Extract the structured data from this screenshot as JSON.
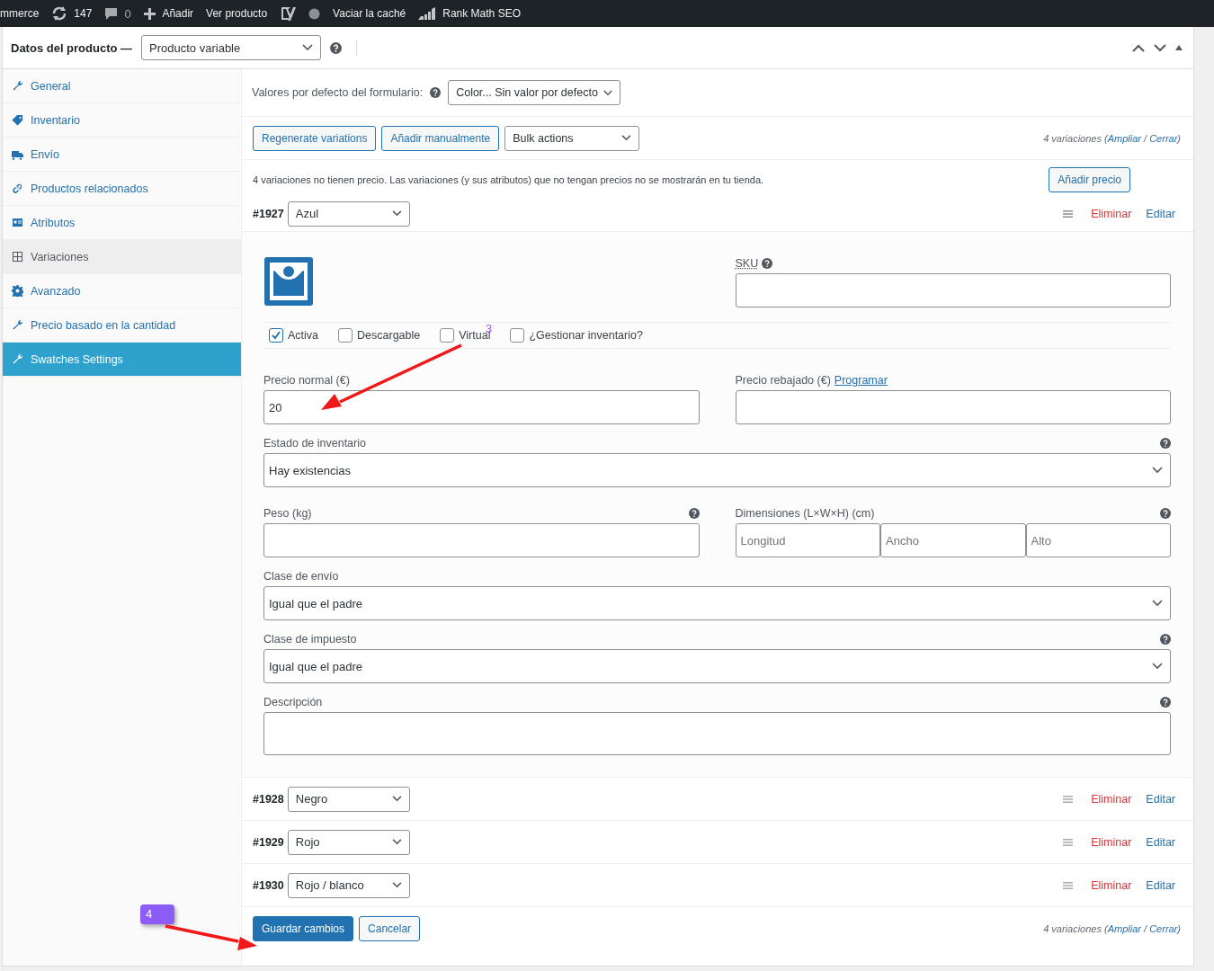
{
  "admin_bar": {
    "items": [
      {
        "kind": "text",
        "label": "mmerce"
      },
      {
        "kind": "updates",
        "label": "147"
      },
      {
        "kind": "comments",
        "label": "0"
      },
      {
        "kind": "add",
        "label": "Añadir"
      },
      {
        "kind": "text",
        "label": "Ver producto"
      },
      {
        "kind": "yoast"
      },
      {
        "kind": "status-dot"
      },
      {
        "kind": "text",
        "label": "Vaciar la caché"
      },
      {
        "kind": "rankmath",
        "label": "Rank Math SEO"
      }
    ]
  },
  "panel": {
    "title": "Datos del producto —",
    "product_type": "Producto variable"
  },
  "tabs": [
    {
      "label": "General",
      "selected": false,
      "highlighted": false
    },
    {
      "label": "Inventario",
      "selected": false,
      "highlighted": false
    },
    {
      "label": "Envío",
      "selected": false,
      "highlighted": false
    },
    {
      "label": "Productos relacionados",
      "selected": false,
      "highlighted": false
    },
    {
      "label": "Atributos",
      "selected": false,
      "highlighted": false
    },
    {
      "label": "Variaciones",
      "selected": true,
      "highlighted": false
    },
    {
      "label": "Avanzado",
      "selected": false,
      "highlighted": false
    },
    {
      "label": "Precio basado en la cantidad",
      "selected": false,
      "highlighted": false
    },
    {
      "label": "Swatches Settings",
      "selected": false,
      "highlighted": true
    }
  ],
  "defaults": {
    "label": "Valores por defecto del formulario:",
    "value": "Color... Sin valor por defecto"
  },
  "toolbar": {
    "buttons": [
      "Regenerate variations",
      "Añadir manualmente"
    ],
    "bulk": "Bulk actions",
    "summary": [
      {
        "kind": "text",
        "text": "4 variaciones ("
      },
      {
        "kind": "link",
        "text": "Ampliar"
      },
      {
        "kind": "text",
        "text": " / "
      },
      {
        "kind": "link",
        "text": "Cerrar"
      },
      {
        "kind": "text",
        "text": ")"
      }
    ]
  },
  "notice": {
    "text": "4 variaciones no tienen precio. Las variaciones (y sus atributos) que no tengan precios no se mostrarán en tu tienda.",
    "button": "Añadir precio"
  },
  "variations": [
    {
      "id": "#1927",
      "value": "Azul",
      "expanded": true,
      "remove": "Eliminar",
      "edit": "Editar"
    },
    {
      "id": "#1928",
      "value": "Negro",
      "expanded": false,
      "remove": "Eliminar",
      "edit": "Editar"
    },
    {
      "id": "#1929",
      "value": "Rojo",
      "expanded": false,
      "remove": "Eliminar",
      "edit": "Editar"
    },
    {
      "id": "#1930",
      "value": "Rojo / blanco",
      "expanded": false,
      "remove": "Eliminar",
      "edit": "Editar"
    }
  ],
  "variation_form": {
    "sku": "SKU",
    "checkboxes": [
      {
        "label": "Activa",
        "checked": true
      },
      {
        "label": "Descargable",
        "checked": false
      },
      {
        "label": "Virtual",
        "checked": false
      },
      {
        "label": "¿Gestionar inventario?",
        "checked": false
      }
    ],
    "regular_price": {
      "label": "Precio normal (€)",
      "value": "20"
    },
    "sale_price": {
      "label": "Precio rebajado (€)",
      "link": "Programar"
    },
    "stock": {
      "label": "Estado de inventario",
      "value": "Hay existencias"
    },
    "weight": {
      "label": "Peso (kg)"
    },
    "dimensions": {
      "label": "Dimensiones (L×W×H) (cm)",
      "placeholders": [
        "Longitud",
        "Ancho",
        "Alto"
      ]
    },
    "shipping_class": {
      "label": "Clase de envío",
      "value": "Igual que el padre"
    },
    "tax_class": {
      "label": "Clase de impuesto",
      "value": "Igual que el padre"
    },
    "description": {
      "label": "Descripción"
    }
  },
  "footer": {
    "save": "Guardar cambios",
    "cancel": "Cancelar",
    "summary": [
      {
        "kind": "text",
        "text": "4 variaciones ("
      },
      {
        "kind": "link",
        "text": "Ampliar"
      },
      {
        "kind": "text",
        "text": " / "
      },
      {
        "kind": "link",
        "text": "Cerrar"
      },
      {
        "kind": "text",
        "text": ")"
      }
    ]
  },
  "annotations": [
    {
      "kind": "text",
      "label": "3"
    },
    {
      "kind": "badge",
      "label": "4"
    }
  ]
}
